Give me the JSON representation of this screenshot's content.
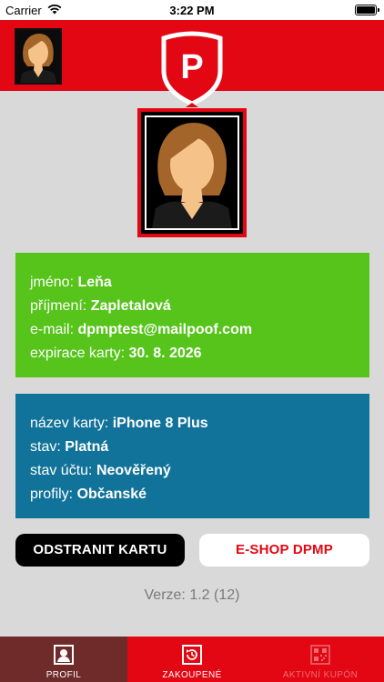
{
  "status_bar": {
    "carrier": "Carrier",
    "time": "3:22 PM"
  },
  "header": {
    "logo_letter": "P"
  },
  "profile": {
    "name_label": "jméno:",
    "name_value": "Leňa",
    "surname_label": "příjmení:",
    "surname_value": "Zapletalová",
    "email_label": "e-mail:",
    "email_value": "dpmptest@mailpoof.com",
    "expiry_label": "expirace karty:",
    "expiry_value": "30. 8. 2026"
  },
  "card_info": {
    "card_name_label": "název karty:",
    "card_name_value": "iPhone 8 Plus",
    "state_label": "stav:",
    "state_value": "Platná",
    "account_state_label": "stav účtu:",
    "account_state_value": "Neověřený",
    "profiles_label": "profily:",
    "profiles_value": "Občanské"
  },
  "buttons": {
    "remove_card": "ODSTRANIT KARTU",
    "eshop": "E-SHOP DPMP"
  },
  "version": "Verze: 1.2 (12)",
  "tabs": [
    {
      "label": "PROFIL",
      "icon": "profile-icon",
      "active": true
    },
    {
      "label": "ZAKOUPENÉ",
      "icon": "purchased-icon",
      "active": false
    },
    {
      "label": "AKTIVNÍ KUPÓN",
      "icon": "coupon-qr-icon",
      "active": false,
      "disabled": true
    }
  ],
  "colors": {
    "brand_red": "#e30613",
    "green_card": "#56c41a",
    "blue_card": "#12739a",
    "active_tab": "#6f2a2a"
  }
}
